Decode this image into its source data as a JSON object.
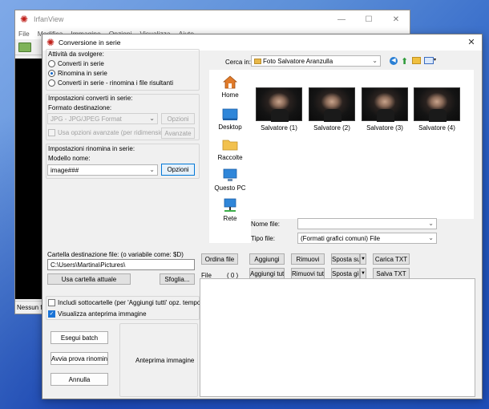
{
  "back_window": {
    "title": "IrfanView",
    "menu": [
      "File",
      "Modifica",
      "Immagine",
      "Opzioni",
      "Visualizza",
      "Aiuto"
    ],
    "status": "Nessun fil"
  },
  "dialog": {
    "title": "Conversione in serie",
    "close": "✕",
    "activity": {
      "label": "Attività da svolgere:",
      "options": [
        "Converti in serie",
        "Rinomina in serie",
        "Converti in serie - rinomina i file risultanti"
      ],
      "selected_index": 1
    },
    "convert": {
      "group_label": "Impostazioni converti in serie:",
      "format_label": "Formato destinazione:",
      "format_value": "JPG - JPG/JPEG Format",
      "options_button": "Opzioni",
      "advanced_checkbox": "Usa opzioni avanzate (per ridimensiona...)",
      "advanced_button": "Avanzate"
    },
    "rename": {
      "group_label": "Impostazioni rinomina in serie:",
      "name_label": "Modello nome:",
      "name_value": "image###",
      "options_button": "Opzioni"
    },
    "destination": {
      "label": "Cartella destinazione file: (o variabile come: $D)",
      "path": "C:\\Users\\Martina\\Pictures\\",
      "use_current_button": "Usa cartella attuale",
      "browse_button": "Sfoglia..."
    },
    "include_subfolders": "Includi sottocartelle (per 'Aggiungi tutti' opz. temporanea)",
    "show_preview": "Visualizza anteprima immagine",
    "buttons": {
      "run_batch": "Esegui batch",
      "test_rename": "Avvia prova rinomina",
      "cancel": "Annulla"
    },
    "preview_label": "Anteprima immagine",
    "browser": {
      "look_in_label": "Cerca in:",
      "look_in_value": "Foto Salvatore Aranzulla",
      "places": [
        "Home",
        "Desktop",
        "Raccolte",
        "Questo PC",
        "Rete"
      ],
      "thumbnails": [
        "Salvatore (1)",
        "Salvatore (2)",
        "Salvatore (3)",
        "Salvatore (4)"
      ],
      "filename_label": "Nome file:",
      "filename_value": "",
      "filetype_label": "Tipo file:",
      "filetype_value": "(Formati grafici comuni) File"
    },
    "list_buttons": {
      "sort": "Ordina file",
      "add": "Aggiungi",
      "remove": "Rimuovi",
      "move_up": "Sposta su",
      "load_txt": "Carica TXT",
      "add_all": "Aggiungi tutti",
      "remove_all": "Rimuovi tutti",
      "move_down": "Sposta giù",
      "save_txt": "Salva TXT"
    },
    "file_label": "File",
    "file_count": "( 0 )"
  },
  "colors": {
    "accent": "#0078d7",
    "logo_red": "#c0201a"
  }
}
